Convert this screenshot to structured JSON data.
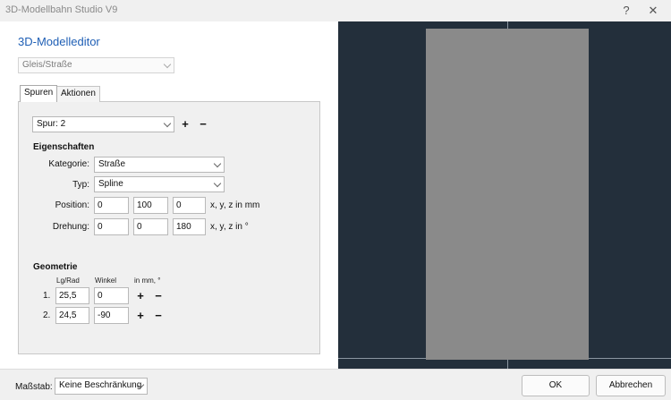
{
  "window": {
    "title": "3D-Modellbahn Studio V9",
    "help_label": "?",
    "close_label": "✕"
  },
  "editor": {
    "title": "3D-Modelleditor",
    "object_type": "Gleis/Straße"
  },
  "tabs": [
    {
      "label": "Spuren"
    },
    {
      "label": "Aktionen"
    }
  ],
  "track": {
    "selected": "Spur: 2",
    "add_label": "+",
    "remove_label": "−"
  },
  "properties": {
    "heading": "Eigenschaften",
    "category_label": "Kategorie:",
    "category_value": "Straße",
    "type_label": "Typ:",
    "type_value": "Spline",
    "position_label": "Position:",
    "position": [
      "0",
      "100",
      "0"
    ],
    "position_unit": "x, y, z in mm",
    "rotation_label": "Drehung:",
    "rotation": [
      "0",
      "0",
      "180"
    ],
    "rotation_unit": "x, y, z in °"
  },
  "geometry": {
    "heading": "Geometrie",
    "col_length": "Lg/Rad",
    "col_angle": "Winkel",
    "col_unit": "in mm, °",
    "rows": [
      {
        "index": "1.",
        "length": "25,5",
        "angle": "0"
      },
      {
        "index": "2.",
        "length": "24,5",
        "angle": "-90"
      }
    ],
    "add_label": "+",
    "remove_label": "−"
  },
  "footer": {
    "scale_label": "Maßstab:",
    "scale_value": "Keine Beschränkung",
    "ok_label": "OK",
    "cancel_label": "Abbrechen"
  },
  "colors": {
    "accent": "#1f5fb5",
    "preview_background": "#232f3b",
    "preview_shape": "#8a8a8a",
    "guide_lines": "#8b96a1"
  }
}
